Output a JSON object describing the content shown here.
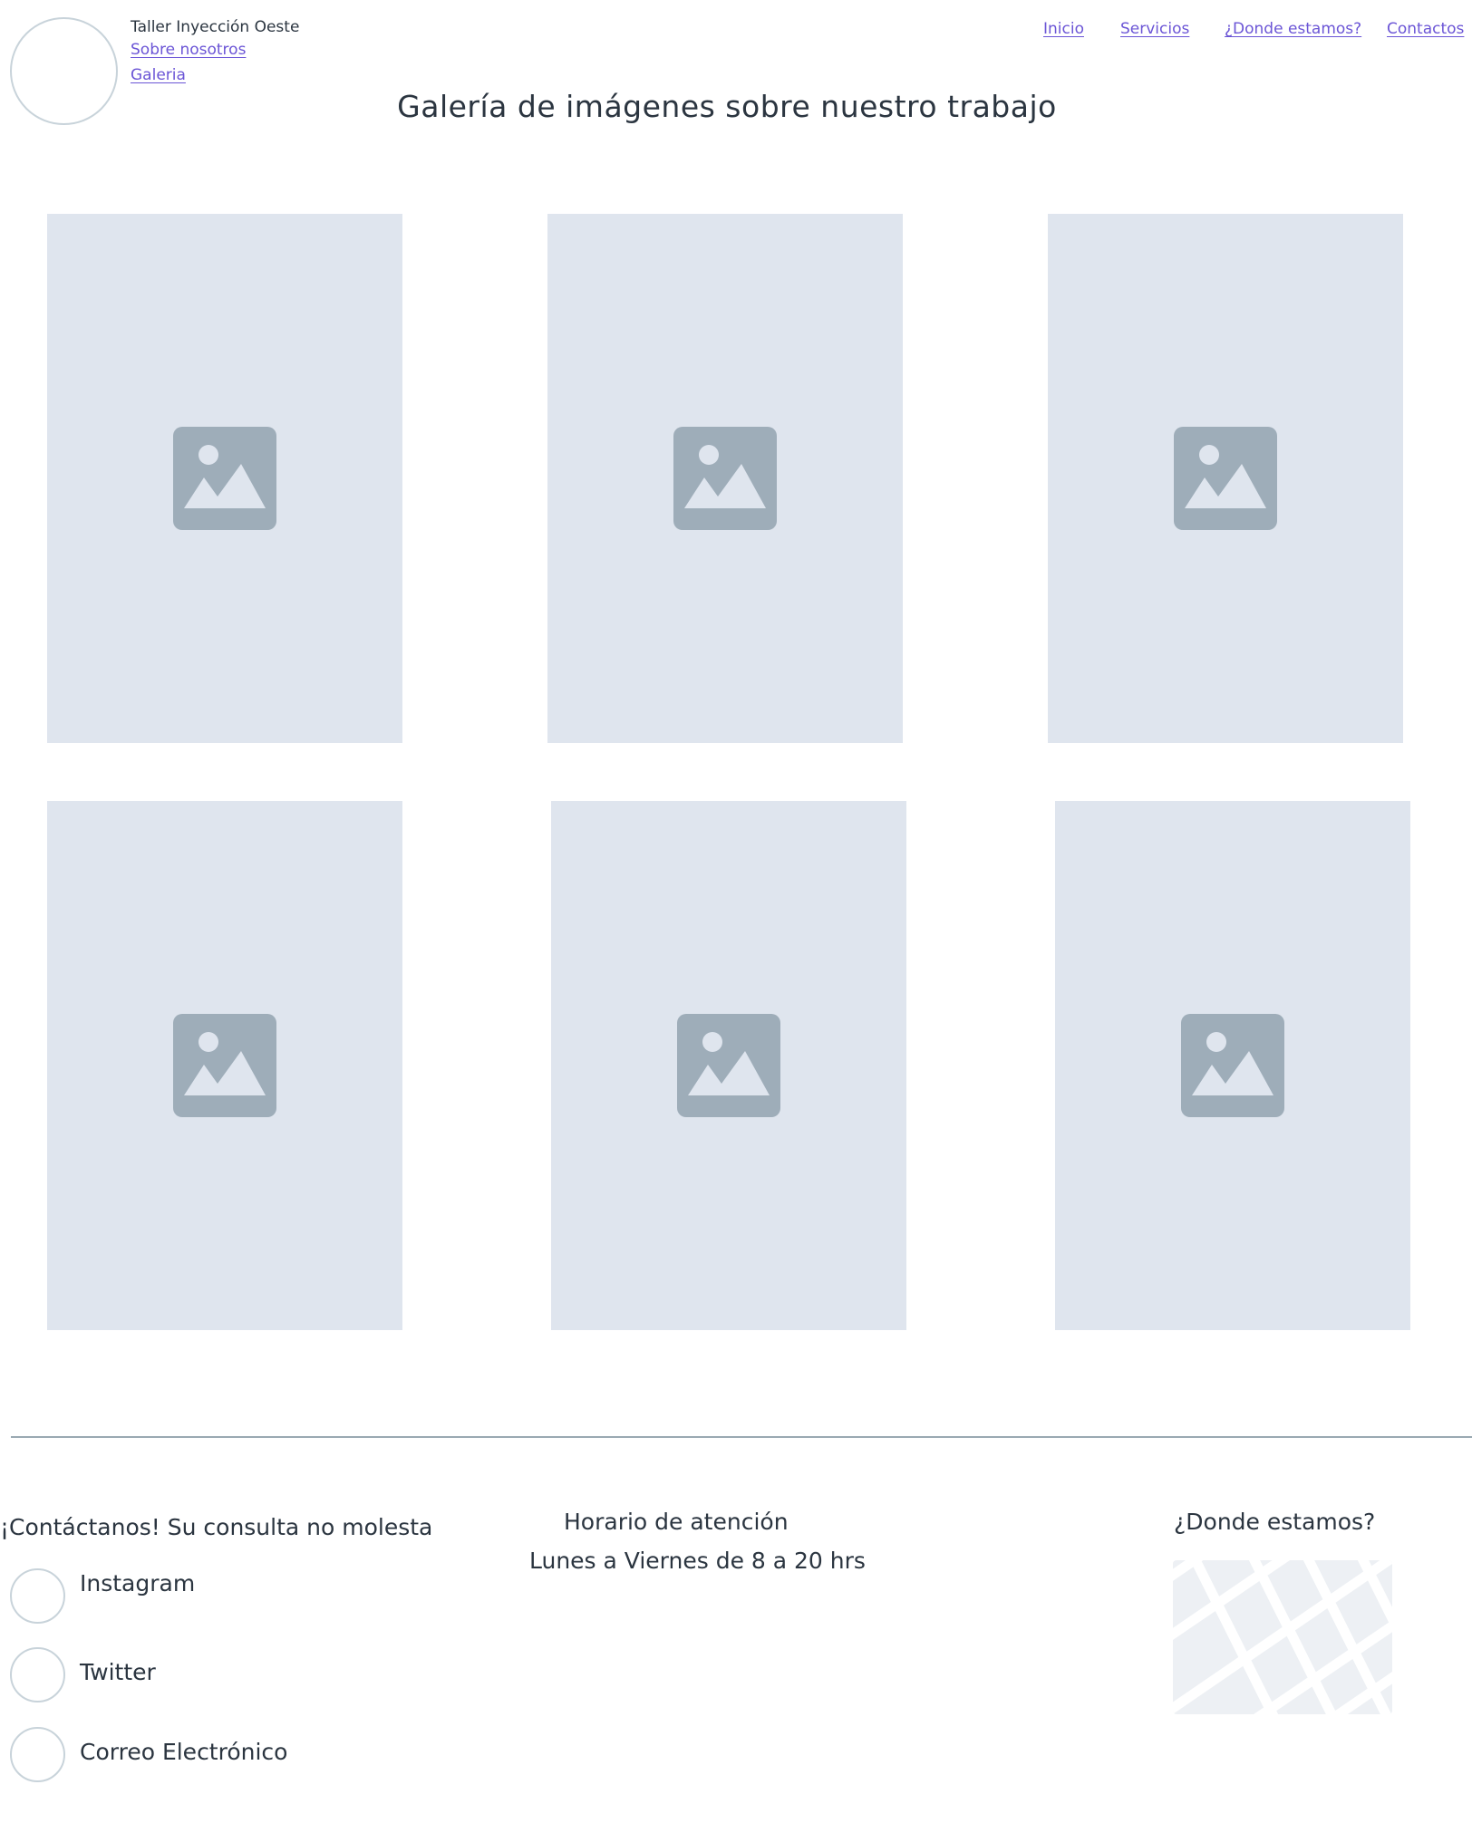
{
  "header": {
    "brand": "Taller Inyección Oeste",
    "side_links": [
      "Sobre nosotros",
      "Galeria"
    ],
    "nav": [
      "Inicio",
      "Servicios",
      "¿Donde estamos?",
      "Contactos"
    ]
  },
  "main": {
    "title": "Galería de imágenes sobre nuestro trabajo",
    "gallery_icon": "image-placeholder-icon"
  },
  "footer": {
    "contact_heading": "¡Contáctanos! Su consulta no molesta",
    "social": [
      "Instagram",
      "Twitter",
      "Correo Electrónico"
    ],
    "hours_heading": "Horario de atención",
    "hours_text": "Lunes a Viernes de 8 a 20 hrs",
    "location_heading": "¿Donde estamos?"
  },
  "colors": {
    "link": "#6b55d6",
    "text": "#2b3540",
    "placeholder_bg": "#dfe5ee",
    "placeholder_icon": "#9eadb9"
  }
}
